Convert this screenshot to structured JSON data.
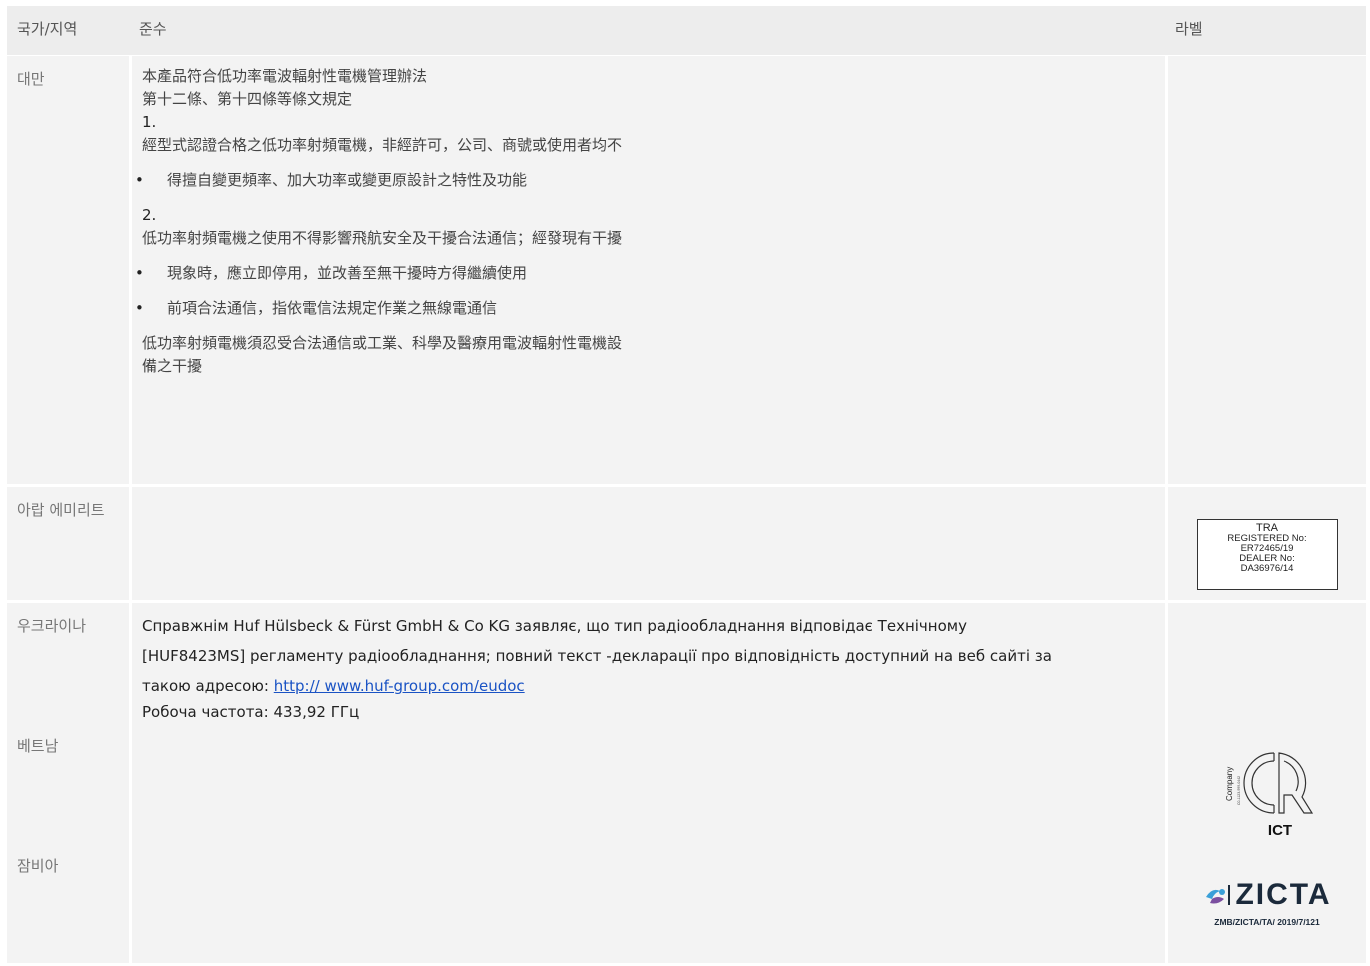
{
  "header": {
    "country": "국가/지역",
    "compliance": "준수",
    "label": "라벨"
  },
  "rows": {
    "taiwan": {
      "country": "대만",
      "line1": "本產品符合低功率電波輻射性電機管理辦法",
      "line2": "第十二條、第十四條等條文規定",
      "num1": "1.",
      "line3": "經型式認證合格之低功率射頻電機，非經許可，公司、商號或使用者均不",
      "bullet1": "得擅自變更頻率、加大功率或變更原設計之特性及功能",
      "num2": "2.",
      "line4": "低功率射頻電機之使用不得影響飛航安全及干擾合法通信；經發現有干擾",
      "bullet2": "現象時，應立即停用，並改善至無干擾時方得繼續使用",
      "bullet3": "前項合法通信，指依電信法規定作業之無線電通信",
      "line5": "低功率射頻電機須忍受合法通信或工業、科學及醫療用電波輻射性電機設",
      "line6": "備之干擾",
      "bullet_symbol": "•"
    },
    "uae": {
      "country": "아랍 에미리트",
      "tra": {
        "l1": "TRA",
        "l2": "REGISTERED No:",
        "l3": "ER72465/19",
        "l4": "DEALER No:",
        "l5": "DA36976/14"
      }
    },
    "ukraine": {
      "country": "우크라이나",
      "text1": "Справжнім Huf Hülsbeck & Fürst GmbH & Co KG заявляє, що тип радіообладнання відповідає Технічному",
      "text2": "[HUF8423MS] регламенту радіообладнання; повний текст -декларації про відповідність доступний на веб сайті за",
      "text3": "такою адресою: ",
      "link": "http:// www.huf-group.com/eudoc",
      "text4": "Робоча частота: 433,92 ГГц"
    },
    "vietnam": {
      "country": "베트남",
      "ict": {
        "company": "Company",
        "small": "C0-1123-999-0442",
        "mark": "ICT"
      }
    },
    "zambia": {
      "country": "잠비아",
      "zicta": {
        "brand": "ZICTA",
        "code": "ZMB/ZICTA/TA/ 2019/7/121"
      }
    }
  }
}
